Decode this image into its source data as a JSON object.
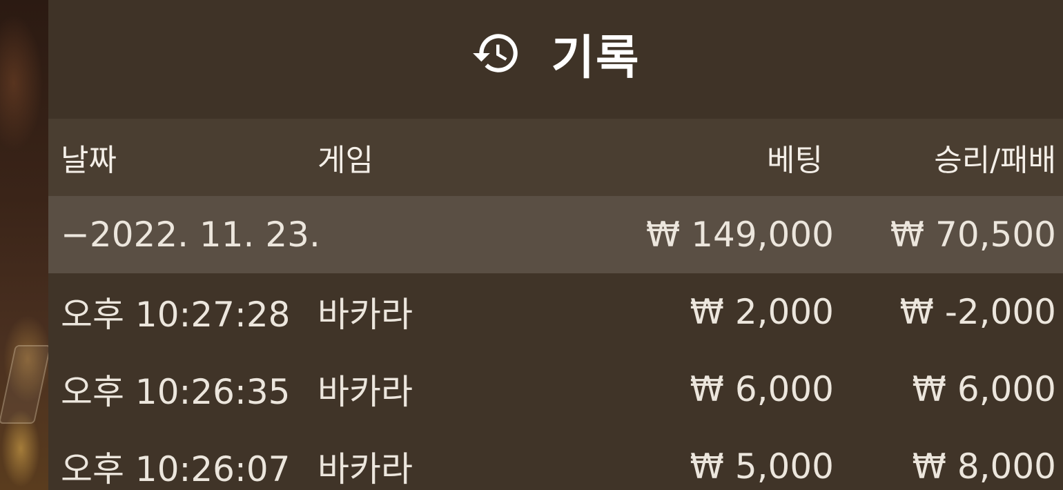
{
  "header": {
    "icon": "history-icon",
    "title": "기록"
  },
  "columns": {
    "date": "날짜",
    "game": "게임",
    "bet": "베팅",
    "win_loss": "승리/패배"
  },
  "summary": {
    "date": "−2022. 11. 23.",
    "bet": "₩ 149,000",
    "win_loss": "₩ 70,500"
  },
  "rows": [
    {
      "time": "오후 10:27:28",
      "game": "바카라",
      "bet": "₩ 2,000",
      "win_loss": "₩ -2,000"
    },
    {
      "time": "오후 10:26:35",
      "game": "바카라",
      "bet": "₩ 6,000",
      "win_loss": "₩ 6,000"
    },
    {
      "time": "오후 10:26:07",
      "game": "바카라",
      "bet": "₩ 5,000",
      "win_loss": "₩ 8,000"
    }
  ],
  "colors": {
    "panel": "#433629",
    "header_row": "#4a3e31",
    "summary_row": "#5a4f44",
    "text": "#f2ede6"
  }
}
